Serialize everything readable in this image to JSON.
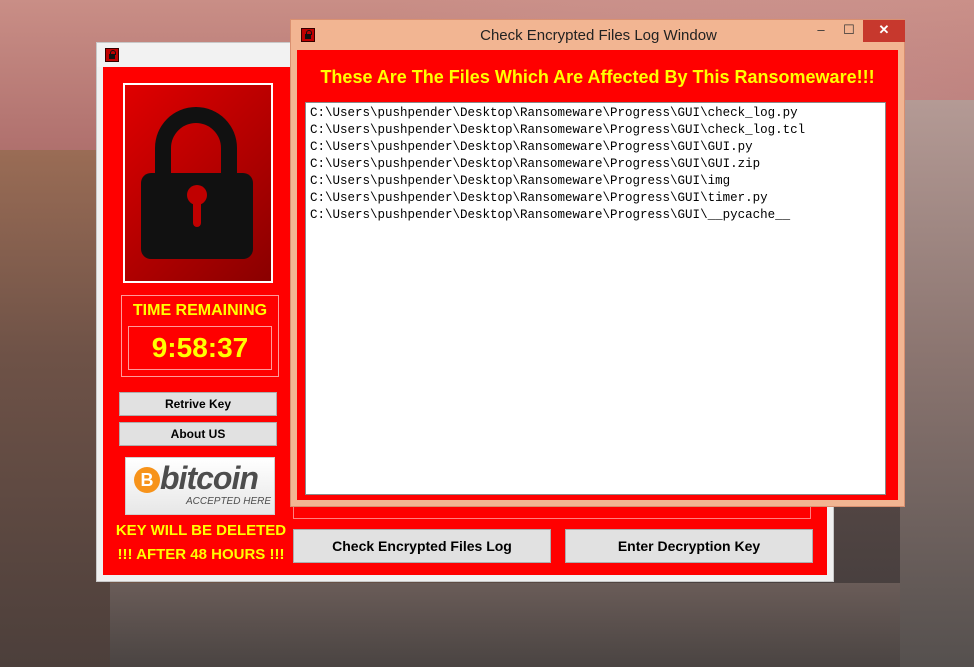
{
  "main_window": {
    "time_label": "TIME REMAINING",
    "time_value": "9:58:37",
    "retrieve_key_label": "Retrive Key",
    "about_us_label": "About US",
    "bitcoin": {
      "symbol": "B",
      "word": "bitcoin",
      "subtitle": "ACCEPTED HERE"
    },
    "warning_line1": "KEY WILL BE DELETED",
    "warning_line2": "!!! AFTER 48 HOURS  !!!",
    "check_log_label": "Check Encrypted Files Log",
    "enter_key_label": "Enter Decryption Key"
  },
  "log_window": {
    "title": "Check Encrypted Files Log Window",
    "controls": {
      "minimize": "–",
      "maximize": "☐",
      "close": "✕"
    },
    "heading": "These Are The Files Which Are Affected By This Ransomeware!!!",
    "files": [
      "C:\\Users\\pushpender\\Desktop\\Ransomeware\\Progress\\GUI\\check_log.py",
      "C:\\Users\\pushpender\\Desktop\\Ransomeware\\Progress\\GUI\\check_log.tcl",
      "C:\\Users\\pushpender\\Desktop\\Ransomeware\\Progress\\GUI\\GUI.py",
      "C:\\Users\\pushpender\\Desktop\\Ransomeware\\Progress\\GUI\\GUI.zip",
      "C:\\Users\\pushpender\\Desktop\\Ransomeware\\Progress\\GUI\\img",
      "C:\\Users\\pushpender\\Desktop\\Ransomeware\\Progress\\GUI\\timer.py",
      "C:\\Users\\pushpender\\Desktop\\Ransomeware\\Progress\\GUI\\__pycache__"
    ]
  },
  "colors": {
    "app_background": "#ff0000",
    "accent_text": "#ffff00",
    "log_frame": "#f2b592",
    "close_button": "#c7382d",
    "bitcoin_orange": "#f7931a"
  }
}
